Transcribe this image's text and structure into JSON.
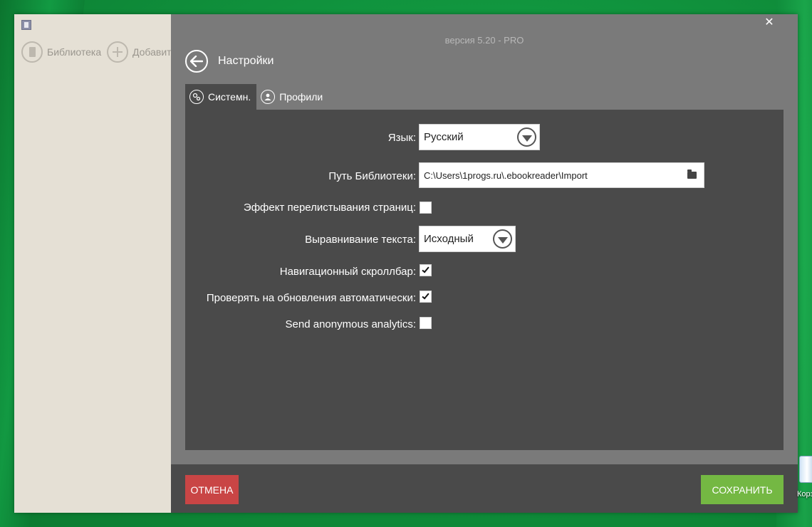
{
  "sidebar": {
    "items": [
      {
        "label": "Библиотека",
        "icon": "book-icon"
      },
      {
        "label": "Добавит",
        "icon": "plus-icon"
      }
    ]
  },
  "header": {
    "version": "версия 5.20 - PRO",
    "title": "Настройки",
    "close_glyph": "✕"
  },
  "tabs": [
    {
      "label": "Системн.",
      "icon": "gears-icon",
      "active": true
    },
    {
      "label": "Профили",
      "icon": "user-icon",
      "active": false
    }
  ],
  "settings": {
    "language_label": "Язык:",
    "language_value": "Русский",
    "library_path_label": "Путь Библиотеки:",
    "library_path_value": "C:\\Users\\1progs.ru\\.ebookreader\\Import",
    "page_flip_label": "Эффект перелистывания страниц:",
    "page_flip_checked": false,
    "text_align_label": "Выравнивание текста:",
    "text_align_value": "Исходный",
    "nav_scrollbar_label": "Навигационный скроллбар:",
    "nav_scrollbar_checked": true,
    "auto_update_label": "Проверять на обновления автоматически:",
    "auto_update_checked": true,
    "analytics_label": "Send anonymous analytics:",
    "analytics_checked": false
  },
  "footer": {
    "cancel_label": "ОТМЕНА",
    "save_label": "СОХРАНИТЬ"
  },
  "desktop": {
    "recycle_label": "Корз"
  },
  "colors": {
    "cancel": "#c94545",
    "save": "#74b843",
    "panel": "#4a4a4a",
    "overlay": "#7a7a7a",
    "sidebar": "#e5e0d5"
  }
}
